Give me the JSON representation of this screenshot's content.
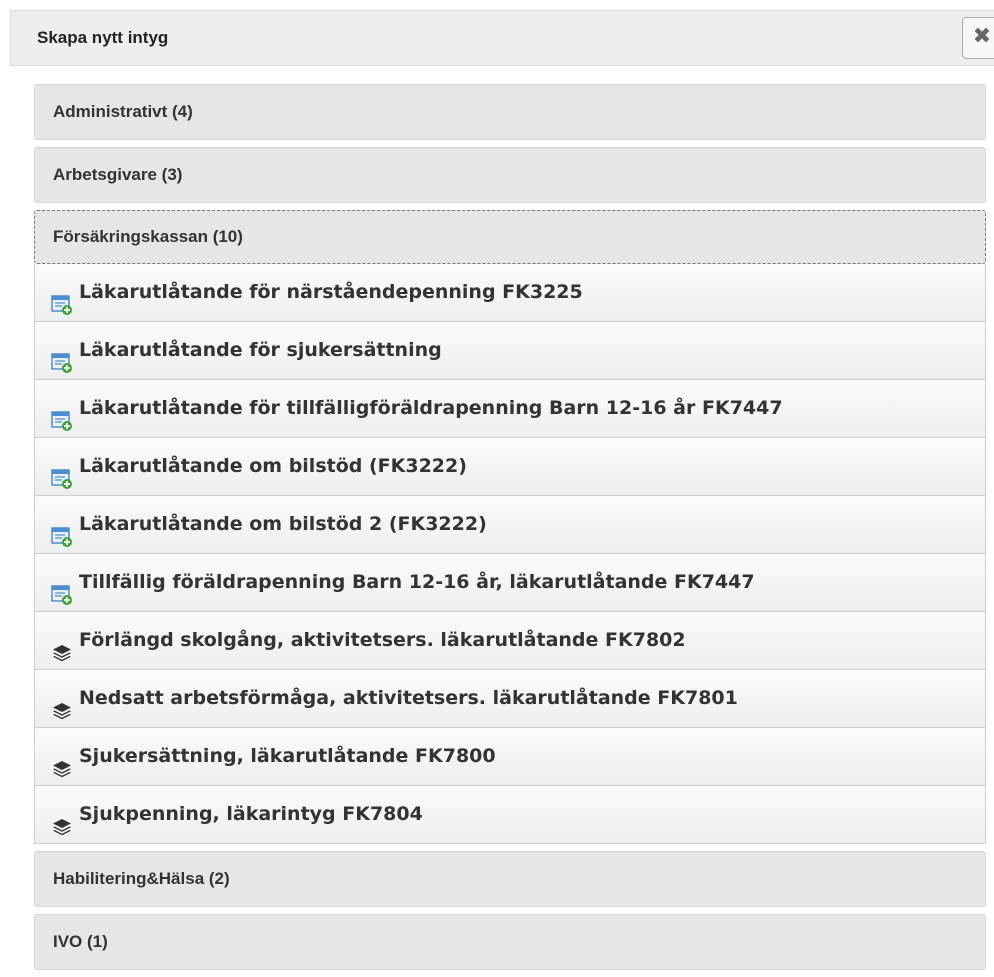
{
  "header": {
    "title": "Skapa nytt intyg",
    "close_icon": "close-x-icon"
  },
  "categories": [
    {
      "label": "Administrativt (4)"
    },
    {
      "label": "Arbetsgivare (3)"
    },
    {
      "label": "Försäkringskassan (10)",
      "expanded": true
    },
    {
      "label": "Habilitering&Hälsa (2)"
    },
    {
      "label": "IVO (1)"
    }
  ],
  "forsakringskassan_items": [
    {
      "label": "Läkarutlåtande för närståendepenning FK3225",
      "icon": "form-add-icon"
    },
    {
      "label": "Läkarutlåtande för sjukersättning",
      "icon": "form-add-icon"
    },
    {
      "label": "Läkarutlåtande för tillfälligföräldrapenning Barn 12-16 år FK7447",
      "icon": "form-add-icon"
    },
    {
      "label": "Läkarutlåtande om bilstöd (FK3222)",
      "icon": "form-add-icon"
    },
    {
      "label": "Läkarutlåtande om bilstöd 2 (FK3222)",
      "icon": "form-add-icon"
    },
    {
      "label": "Tillfällig föräldrapenning Barn 12-16 år, läkarutlåtande FK7447",
      "icon": "form-add-icon"
    },
    {
      "label": "Förlängd skolgång, aktivitetsers. läkarutlåtande FK7802",
      "icon": "layers-icon"
    },
    {
      "label": "Nedsatt arbetsförmåga, aktivitetsers. läkarutlåtande FK7801",
      "icon": "layers-icon"
    },
    {
      "label": "Sjukersättning, läkarutlåtande FK7800",
      "icon": "layers-icon"
    },
    {
      "label": "Sjukpenning, läkarintyg FK7804",
      "icon": "layers-icon"
    }
  ],
  "colors": {
    "header_bg": "#eeeeee",
    "category_bg": "#e6e6e6",
    "form_icon_blue": "#4a8fd0",
    "form_icon_green": "#3aa335",
    "layers_icon": "#333333"
  }
}
